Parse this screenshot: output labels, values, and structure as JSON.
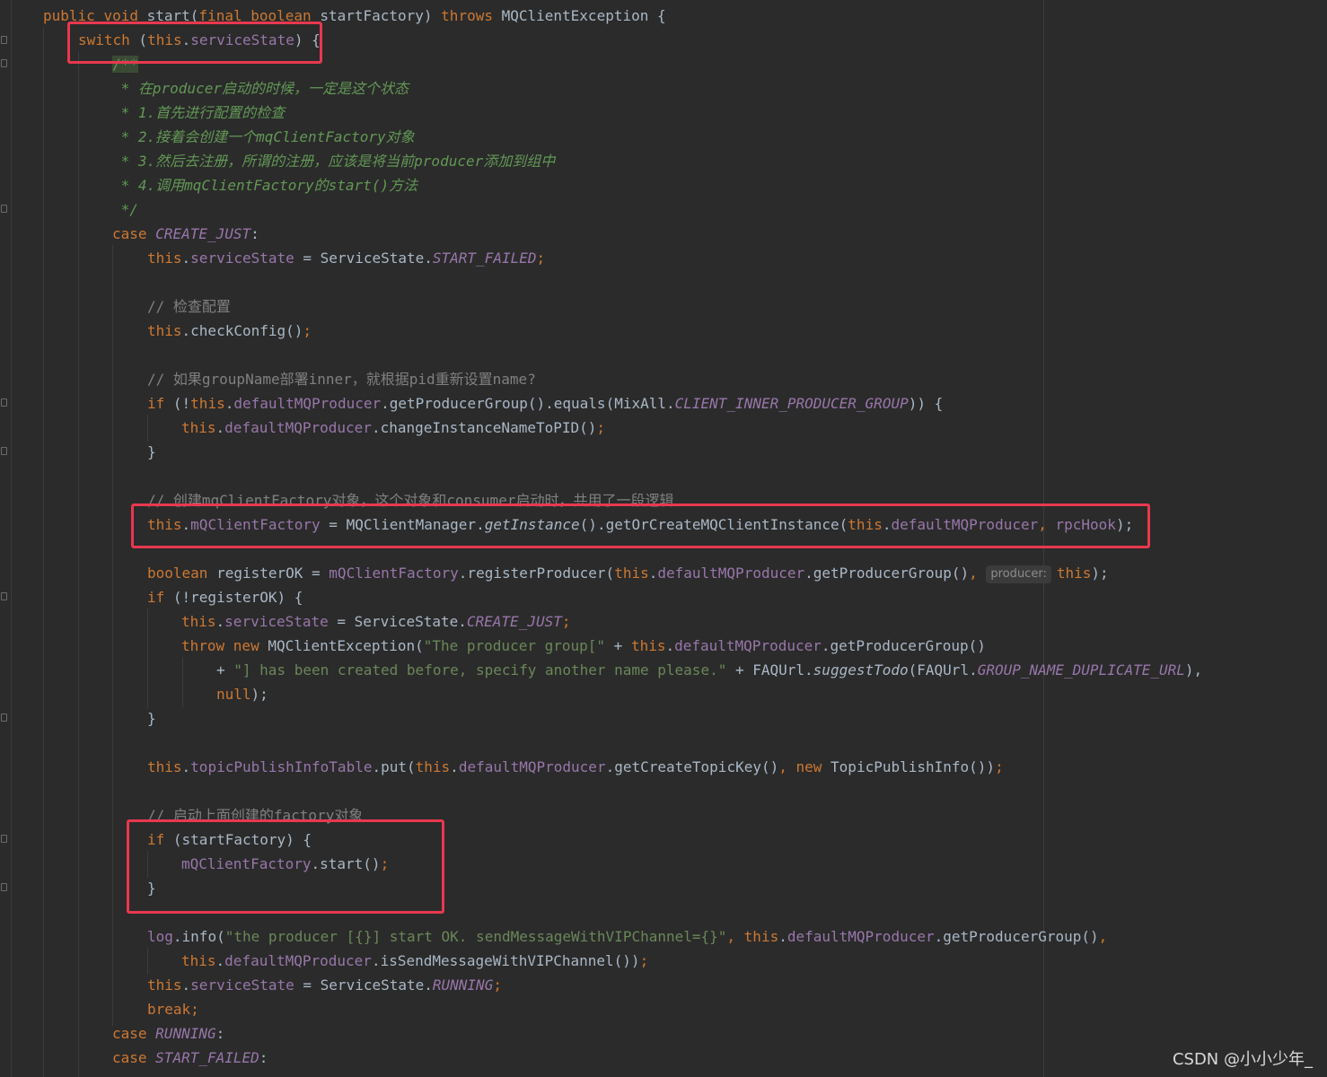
{
  "editor": {
    "lines": {
      "l1": {
        "t1": "public",
        "t2": "void",
        "t3": "start",
        "t4": "(",
        "t5": "final",
        "t6": "boolean",
        "t7": "startFactory) ",
        "t8": "throws",
        "t9": " MQClientException {"
      },
      "l2": {
        "t1": "switch",
        "t2": " (",
        "t3": "this",
        "t4": ".",
        "t5": "serviceState",
        "t6": ") {"
      },
      "l3": {
        "t1": "/**"
      },
      "l4": {
        "t1": " * 在producer启动的时候，一定是这个状态"
      },
      "l5": {
        "t1": " * 1.首先进行配置的检查"
      },
      "l6": {
        "t1": " * 2.接着会创建一个mqClientFactory对象"
      },
      "l7": {
        "t1": " * 3.然后去注册，所谓的注册，应该是将当前producer添加到组中"
      },
      "l8": {
        "t1": " * 4.调用mqClientFactory的start()方法"
      },
      "l9": {
        "t1": " */"
      },
      "l10": {
        "t1": "case",
        "t2": "CREATE_JUST",
        "t3": ":"
      },
      "l11": {
        "t1": "this",
        "t2": ".",
        "t3": "serviceState",
        "t4": " = ServiceState.",
        "t5": "START_FAILED",
        "t6": ";"
      },
      "l12": {
        "t1": "// 检查配置"
      },
      "l13": {
        "t1": "this",
        "t2": ".checkConfig()",
        "t3": ";"
      },
      "l14": {
        "t1": "// 如果groupName部署inner，就根据pid重新设置name?"
      },
      "l15": {
        "t1": "if",
        "t2": " (!",
        "t3": "this",
        "t4": ".",
        "t5": "defaultMQProducer",
        "t6": ".getProducerGroup().equals(MixAll.",
        "t7": "CLIENT_INNER_PRODUCER_GROUP",
        "t8": ")) {"
      },
      "l16": {
        "t1": "this",
        "t2": ".",
        "t3": "defaultMQProducer",
        "t4": ".changeInstanceNameToPID()",
        "t5": ";"
      },
      "l17": {
        "t1": "}"
      },
      "l18": {
        "t1": "// 创建mqClientFactory对象，这个对象和consumer启动时，共用了一段逻辑"
      },
      "l19": {
        "t1": "this",
        "t2": ".",
        "t3": "mQClientFactory",
        "t4": " = MQClientManager.",
        "t5": "getInstance",
        "t6": "().getOrCreateMQClientInstance(",
        "t7": "this",
        "t8": ".",
        "t9": "defaultMQProducer",
        "t10": ", ",
        "t11": "rpcHook",
        "t12": ");"
      },
      "l20": {
        "t1": "boolean",
        "t2": " registerOK = ",
        "t3": "mQClientFactory",
        "t4": ".registerProducer(",
        "t5": "this",
        "t6": ".",
        "t7": "defaultMQProducer",
        "t8": ".getProducerGroup()",
        "t9": ", ",
        "hint": "producer:",
        "t10": "this",
        "t11": ");"
      },
      "l21": {
        "t1": "if",
        "t2": " (!registerOK) {"
      },
      "l22": {
        "t1": "this",
        "t2": ".",
        "t3": "serviceState",
        "t4": " = ServiceState.",
        "t5": "CREATE_JUST",
        "t6": ";"
      },
      "l23": {
        "t1": "throw new",
        "t2": " MQClientException(",
        "t3": "\"The producer group[\"",
        "t4": " + ",
        "t5": "this",
        "t6": ".",
        "t7": "defaultMQProducer",
        "t8": ".getProducerGroup()"
      },
      "l24": {
        "t1": "+ ",
        "t2": "\"] has been created before, specify another name please.\"",
        "t3": " + FAQUrl.",
        "t4": "suggestTodo",
        "t5": "(FAQUrl.",
        "t6": "GROUP_NAME_DUPLICATE_URL",
        "t7": "),"
      },
      "l25": {
        "t1": "null",
        "t2": ");"
      },
      "l26": {
        "t1": "}"
      },
      "l27": {
        "t1": "this",
        "t2": ".",
        "t3": "topicPublishInfoTable",
        "t4": ".put(",
        "t5": "this",
        "t6": ".",
        "t7": "defaultMQProducer",
        "t8": ".getCreateTopicKey()",
        "t9": ", ",
        "t10": "new",
        "t11": " TopicPublishInfo())",
        "t12": ";"
      },
      "l28": {
        "t1": "// 启动上面创建的factory对象"
      },
      "l29": {
        "t1": "if",
        "t2": " (startFactory) {"
      },
      "l30": {
        "t1": "mQClientFactory",
        "t2": ".start()",
        "t3": ";"
      },
      "l31": {
        "t1": "}"
      },
      "l32": {
        "t1": "log",
        "t2": ".info(",
        "t3": "\"the producer [{}] start OK. sendMessageWithVIPChannel={}\"",
        "t4": ", ",
        "t5": "this",
        "t6": ".",
        "t7": "defaultMQProducer",
        "t8": ".getProducerGroup()",
        "t9": ","
      },
      "l33": {
        "t1": "this",
        "t2": ".",
        "t3": "defaultMQProducer",
        "t4": ".isSendMessageWithVIPChannel())",
        "t5": ";"
      },
      "l34": {
        "t1": "this",
        "t2": ".",
        "t3": "serviceState",
        "t4": " = ServiceState.",
        "t5": "RUNNING",
        "t6": ";"
      },
      "l35": {
        "t1": "break;"
      },
      "l36": {
        "t1": "case",
        "t2": "RUNNING",
        "t3": ":"
      },
      "l37": {
        "t1": "case",
        "t2": "START_FAILED",
        "t3": ":"
      }
    }
  },
  "colors": {
    "background": "#2b2b2b",
    "keyword": "#cc7832",
    "field": "#9876aa",
    "string": "#6a8759",
    "comment": "#808080",
    "doc_comment": "#629755",
    "highlight_box": "#e8384f"
  },
  "watermark": "CSDN @小小少年_"
}
